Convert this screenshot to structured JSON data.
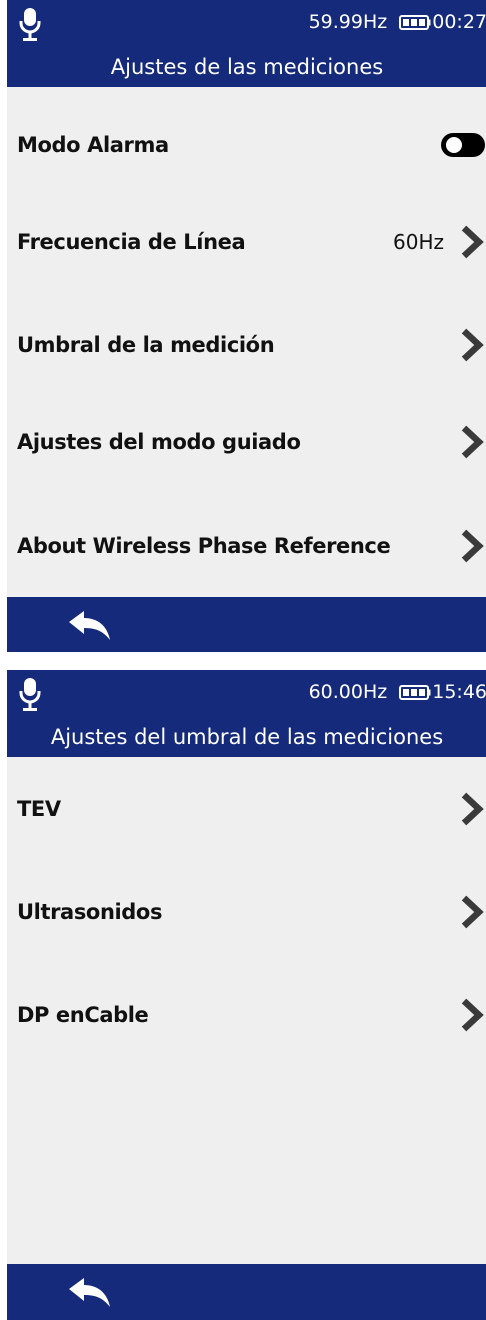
{
  "screen1": {
    "status": {
      "frequency": "59.99Hz",
      "time": "00:27"
    },
    "title": "Ajustes de las mediciones",
    "items": [
      {
        "label": "Modo Alarma",
        "control": "toggle"
      },
      {
        "label": "Frecuencia de Línea",
        "value": "60Hz"
      },
      {
        "label": "Umbral de la medición"
      },
      {
        "label": "Ajustes del modo guiado"
      },
      {
        "label": "About Wireless Phase Reference"
      }
    ]
  },
  "screen2": {
    "status": {
      "frequency": "60.00Hz",
      "time": "15:46"
    },
    "title": "Ajustes del umbral de las mediciones",
    "items": [
      {
        "label": "TEV"
      },
      {
        "label": "Ultrasonidos"
      },
      {
        "label": "DP enCable"
      }
    ]
  },
  "icons": {
    "status": [
      "microphone-icon",
      "battery-icon"
    ],
    "row": "chevron-right-icon",
    "footer": "back-arrow-icon"
  },
  "colors": {
    "header_bg": "#152a7a",
    "content_bg": "#efefef",
    "text": "#111111",
    "toggle": "#000000"
  }
}
